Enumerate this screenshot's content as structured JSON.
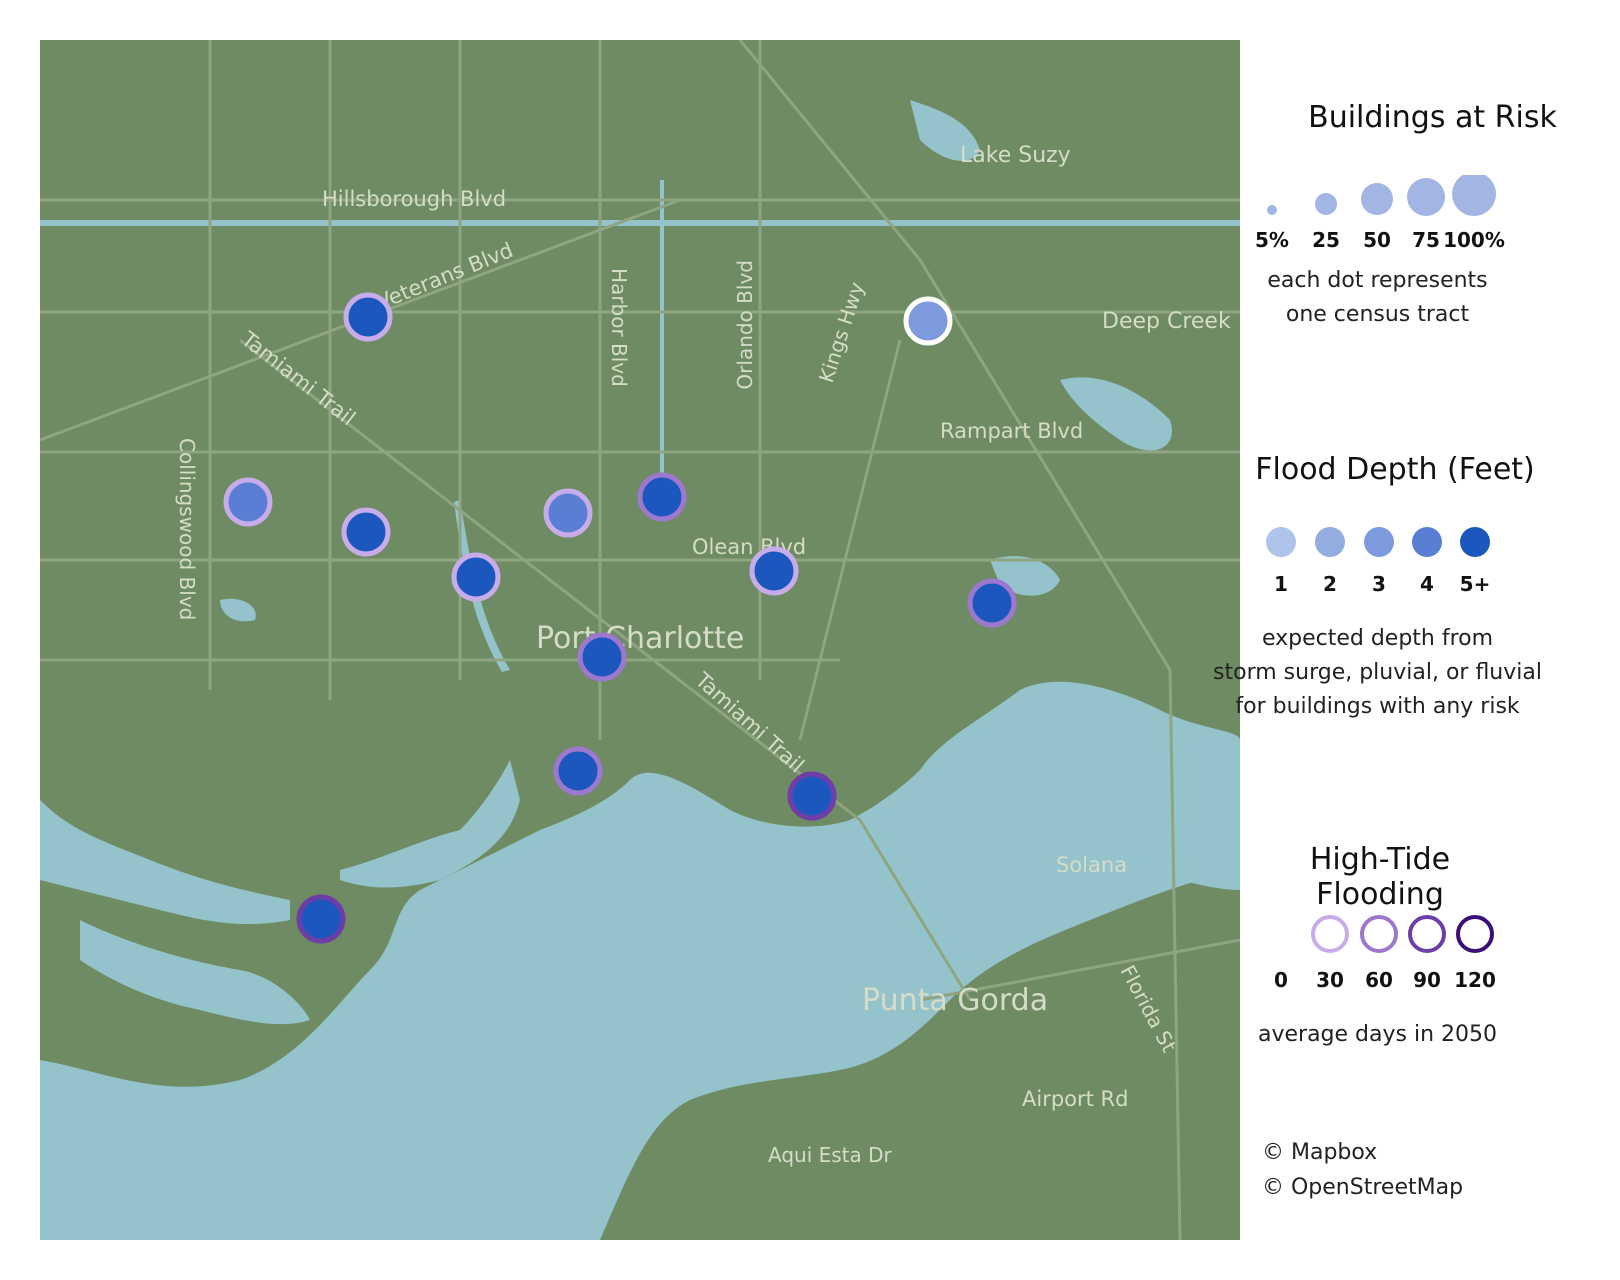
{
  "map": {
    "place_labels": [
      {
        "id": "lake-suzy",
        "text": "Lake Suzy"
      },
      {
        "id": "hillsborough",
        "text": "Hillsborough Blvd"
      },
      {
        "id": "veterans",
        "text": "Veterans Blvd"
      },
      {
        "id": "harbor",
        "text": "Harbor Blvd"
      },
      {
        "id": "orlando",
        "text": "Orlando Blvd"
      },
      {
        "id": "deep-creek",
        "text": "Deep Creek"
      },
      {
        "id": "tamiami-1",
        "text": "Tamiami Trail"
      },
      {
        "id": "kings-hwy",
        "text": "Kings Hwy"
      },
      {
        "id": "rampart",
        "text": "Rampart Blvd"
      },
      {
        "id": "collingswood",
        "text": "Collingswood Blvd"
      },
      {
        "id": "olean",
        "text": "Olean Blvd"
      },
      {
        "id": "port-charlotte",
        "text": "Port Charlotte"
      },
      {
        "id": "tamiami-2",
        "text": "Tamiami Trail"
      },
      {
        "id": "solana",
        "text": "Solana"
      },
      {
        "id": "punta-gorda",
        "text": "Punta Gorda"
      },
      {
        "id": "florida-st",
        "text": "Florida St"
      },
      {
        "id": "airport",
        "text": "Airport Rd"
      },
      {
        "id": "aqui-esta",
        "text": "Aqui Esta Dr"
      }
    ],
    "tracts": [
      {
        "depth_level": 5,
        "tide_level": 1,
        "buildings_pct": 25
      },
      {
        "depth_level": 3,
        "tide_level": 0,
        "buildings_pct": 25
      },
      {
        "depth_level": 4,
        "tide_level": 1,
        "buildings_pct": 25
      },
      {
        "depth_level": 5,
        "tide_level": 1,
        "buildings_pct": 25
      },
      {
        "depth_level": 5,
        "tide_level": 2,
        "buildings_pct": 25
      },
      {
        "depth_level": 4,
        "tide_level": 1,
        "buildings_pct": 25
      },
      {
        "depth_level": 5,
        "tide_level": 1,
        "buildings_pct": 25
      },
      {
        "depth_level": 5,
        "tide_level": 1,
        "buildings_pct": 25
      },
      {
        "depth_level": 5,
        "tide_level": 2,
        "buildings_pct": 25
      },
      {
        "depth_level": 5,
        "tide_level": 2,
        "buildings_pct": 25
      },
      {
        "depth_level": 5,
        "tide_level": 2,
        "buildings_pct": 25
      },
      {
        "depth_level": 5,
        "tide_level": 3,
        "buildings_pct": 25
      },
      {
        "depth_level": 5,
        "tide_level": 3,
        "buildings_pct": 25
      }
    ]
  },
  "legend": {
    "buildings": {
      "title": "Buildings at Risk",
      "labels": [
        "5%",
        "25",
        "50",
        "75",
        "100%"
      ],
      "note_line1": "each dot represents",
      "note_line2": "one census tract"
    },
    "depth": {
      "title": "Flood Depth (Feet)",
      "labels": [
        "1",
        "2",
        "3",
        "4",
        "5+"
      ],
      "note_line1": "expected depth from",
      "note_line2": "storm surge, pluvial, or fluvial",
      "note_line3": "for buildings with any risk"
    },
    "tide": {
      "title": "High-Tide Flooding",
      "labels": [
        "0",
        "30",
        "60",
        "90",
        "120"
      ],
      "note": "average days in 2050"
    }
  },
  "credits": {
    "mapbox": "© Mapbox",
    "osm": "© OpenStreetMap"
  },
  "colors": {
    "land": "#6e8b63",
    "water": "#95c3cb",
    "road": "#8fa581",
    "depth": [
      "#aec4ea",
      "#93ade1",
      "#7c9add",
      "#5a7ed3",
      "#1c57bd"
    ],
    "tide": [
      "#ffffff",
      "#c8acea",
      "#9c78ce",
      "#6e3ea8",
      "#3a0f78"
    ],
    "legend_size_dot": "#a2b5e3"
  }
}
